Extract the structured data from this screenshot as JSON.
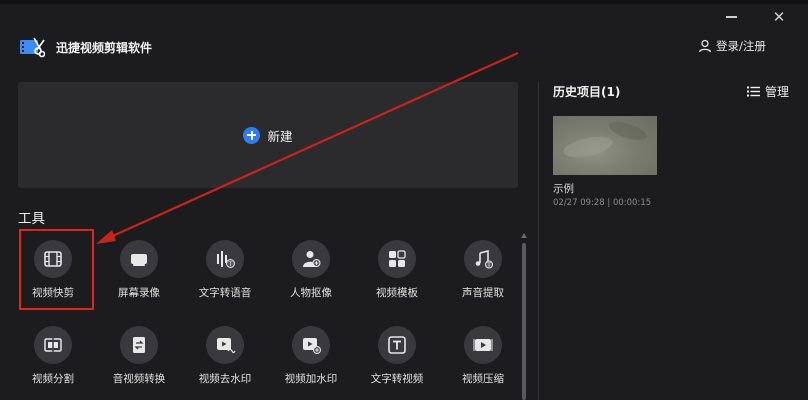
{
  "app": {
    "title": "迅捷视频剪辑软件"
  },
  "header": {
    "login_label": "登录/注册"
  },
  "new_project": {
    "label": "新建"
  },
  "tools": {
    "title": "工具",
    "items": [
      {
        "label": "视频快剪",
        "icon": "film-icon"
      },
      {
        "label": "屏幕录像",
        "icon": "camera-icon"
      },
      {
        "label": "文字转语音",
        "icon": "text-to-speech-icon"
      },
      {
        "label": "人物抠像",
        "icon": "person-cutout-icon"
      },
      {
        "label": "视频模板",
        "icon": "template-icon"
      },
      {
        "label": "声音提取",
        "icon": "music-note-icon"
      },
      {
        "label": "视频分割",
        "icon": "split-icon"
      },
      {
        "label": "音视频转换",
        "icon": "convert-icon"
      },
      {
        "label": "视频去水印",
        "icon": "remove-watermark-icon"
      },
      {
        "label": "视频加水印",
        "icon": "add-watermark-icon"
      },
      {
        "label": "文字转视频",
        "icon": "text-to-video-icon"
      },
      {
        "label": "视频压缩",
        "icon": "compress-icon"
      }
    ]
  },
  "history": {
    "title": "历史项目(1)",
    "manage_label": "管理",
    "items": [
      {
        "name": "示例",
        "meta": "02/27 09:28 | 00:00:15"
      }
    ]
  },
  "colors": {
    "accent": "#2f7cf6",
    "highlight": "#e0251c",
    "background": "#1c1c1e",
    "card": "#2b2b2e"
  }
}
